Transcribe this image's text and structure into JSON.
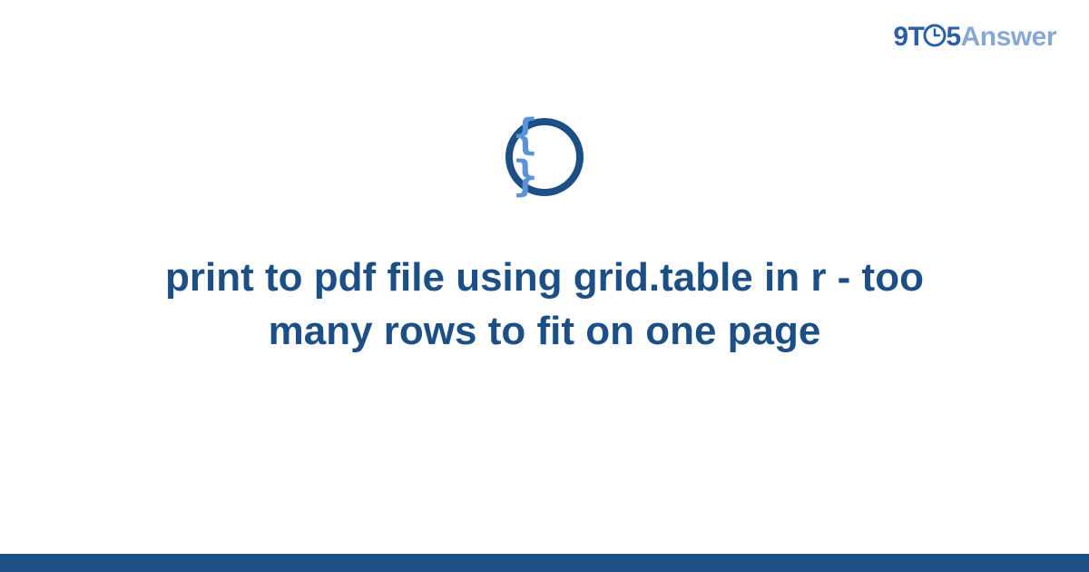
{
  "brand": {
    "part1": "9T",
    "part2": "5",
    "part3": "Answer"
  },
  "icon": {
    "braces": "{ }"
  },
  "title": "print to pdf file using grid.table in r - too many rows to fit on one page",
  "colors": {
    "primary": "#1d4f87",
    "brand_blue": "#2a5ea8",
    "brand_light": "#88a8d4",
    "icon_blue": "#5b93d6"
  }
}
